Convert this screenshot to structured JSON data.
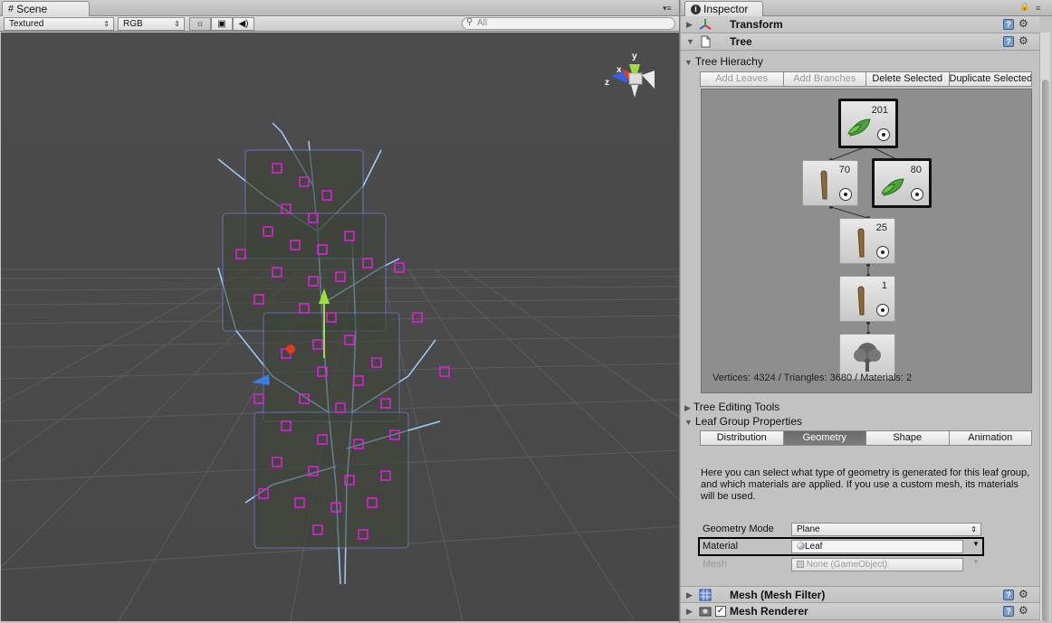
{
  "scene": {
    "tab_label": "Scene",
    "render_mode": "Textured",
    "color_mode": "RGB",
    "search_placeholder": "All",
    "gizmo": {
      "y_label": "y",
      "x_label": "x",
      "z_label": "z"
    }
  },
  "inspector": {
    "tab_label": "Inspector",
    "components": {
      "transform": "Transform",
      "tree": "Tree",
      "mesh_filter": "Mesh (Mesh Filter)",
      "mesh_renderer": "Mesh Renderer"
    },
    "tree_hierarchy": {
      "title": "Tree Hierachy",
      "buttons": [
        "Add Leaves",
        "Add Branches",
        "Delete Selected",
        "Duplicate Selected"
      ],
      "nodes": [
        {
          "count": "201",
          "icon": "leaf-icon"
        },
        {
          "count": "70",
          "icon": "branch-icon"
        },
        {
          "count": "80",
          "icon": "leaf-icon"
        },
        {
          "count": "25",
          "icon": "branch-icon"
        },
        {
          "count": "1",
          "icon": "branch-icon"
        },
        {
          "count": "",
          "icon": "tree-root-icon"
        }
      ],
      "stats": "Vertices: 4324 / Triangles: 3680 / Materials: 2"
    },
    "tree_editing_tools": "Tree Editing Tools",
    "leaf_group": {
      "title": "Leaf Group Properties",
      "tabs": [
        "Distribution",
        "Geometry",
        "Shape",
        "Animation"
      ],
      "active_tab": "Geometry",
      "description": "Here you can select what type of geometry is generated for this leaf group, and which materials are applied. If you use a custom mesh, its materials will be used.",
      "geometry_mode_label": "Geometry Mode",
      "geometry_mode_value": "Plane",
      "material_label": "Material",
      "material_value": "Leaf",
      "mesh_label": "Mesh",
      "mesh_value": "None (GameObject)"
    }
  }
}
